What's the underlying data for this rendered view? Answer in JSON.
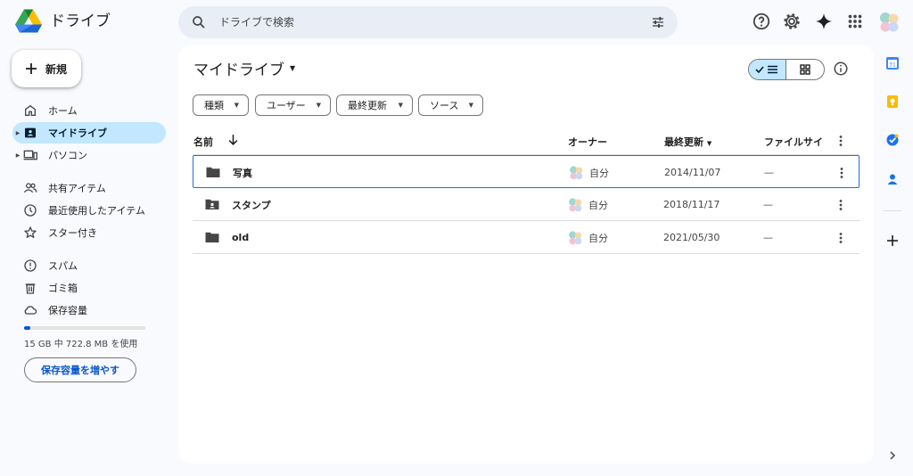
{
  "header": {
    "app_title": "ドライブ",
    "search_placeholder": "ドライブで検索"
  },
  "sidebar": {
    "new_label": "新規",
    "items": [
      {
        "label": "ホーム",
        "icon": "home-icon"
      },
      {
        "label": "マイドライブ",
        "icon": "my-drive-icon",
        "active": true
      },
      {
        "label": "パソコン",
        "icon": "computer-icon"
      },
      {
        "label": "共有アイテム",
        "icon": "shared-people-icon"
      },
      {
        "label": "最近使用したアイテム",
        "icon": "clock-icon"
      },
      {
        "label": "スター付き",
        "icon": "star-icon"
      },
      {
        "label": "スパム",
        "icon": "spam-icon"
      },
      {
        "label": "ゴミ箱",
        "icon": "trash-icon"
      },
      {
        "label": "保存容量",
        "icon": "cloud-icon"
      }
    ],
    "storage_text": "15 GB 中 722.8 MB を使用",
    "storage_fraction": 0.048,
    "more_storage_label": "保存容量を増やす"
  },
  "main": {
    "title": "マイドライブ",
    "filters": [
      "種類",
      "ユーザー",
      "最終更新",
      "ソース"
    ],
    "columns": {
      "name": "名前",
      "owner": "オーナー",
      "modified": "最終更新",
      "size": "ファイルサイ"
    },
    "rows": [
      {
        "name": "写真",
        "icon": "folder-icon",
        "owner": "自分",
        "modified": "2014/11/07",
        "size": "—"
      },
      {
        "name": "スタンプ",
        "icon": "shared-folder-icon",
        "owner": "自分",
        "modified": "2018/11/17",
        "size": "—"
      },
      {
        "name": "old",
        "icon": "folder-icon",
        "owner": "自分",
        "modified": "2021/05/30",
        "size": "—"
      }
    ]
  },
  "colors": {
    "accent": "#0b57d0",
    "active_nav": "#c2e7ff",
    "search_bg": "#e9eef6"
  }
}
